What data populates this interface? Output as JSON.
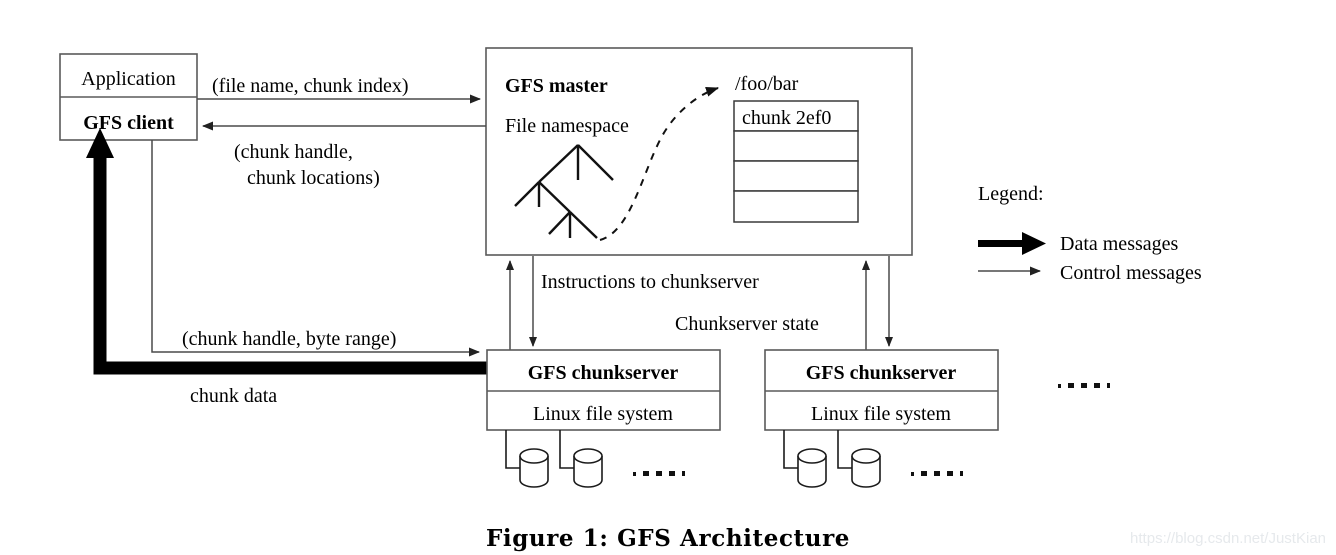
{
  "figure": {
    "caption": "Figure 1: GFS Architecture",
    "watermark": "https://blog.csdn.net/JustKian"
  },
  "client_stack": {
    "application_label": "Application",
    "gfs_client_label": "GFS client"
  },
  "master": {
    "title": "GFS master",
    "namespace_label": "File namespace",
    "file_path_label": "/foo/bar",
    "chunk_table": {
      "rows": [
        "chunk 2ef0",
        "",
        "",
        ""
      ]
    }
  },
  "chunkservers": [
    {
      "title": "GFS chunkserver",
      "filesystem_label": "Linux file system",
      "disk_count": 2,
      "more_disks_label": "....."
    },
    {
      "title": "GFS chunkserver",
      "filesystem_label": "Linux file system",
      "disk_count": 2,
      "more_disks_label": "....."
    }
  ],
  "more_chunkservers_label": ".....",
  "edges": {
    "request_label": "(file name, chunk index)",
    "reply_line1": "(chunk handle,",
    "reply_line2": "chunk locations)",
    "data_request_label": "(chunk handle, byte range)",
    "chunk_data_label": "chunk data",
    "instructions_label": "Instructions to chunkserver",
    "state_label": "Chunkserver state"
  },
  "legend": {
    "title": "Legend:",
    "items": [
      {
        "label": "Data messages",
        "kind": "thick-arrow"
      },
      {
        "label": "Control messages",
        "kind": "thin-arrow"
      }
    ]
  },
  "colors": {
    "stroke": "#4a4a4a",
    "text": "#000000",
    "background": "#ffffff",
    "watermark": "#e6e9ec"
  }
}
